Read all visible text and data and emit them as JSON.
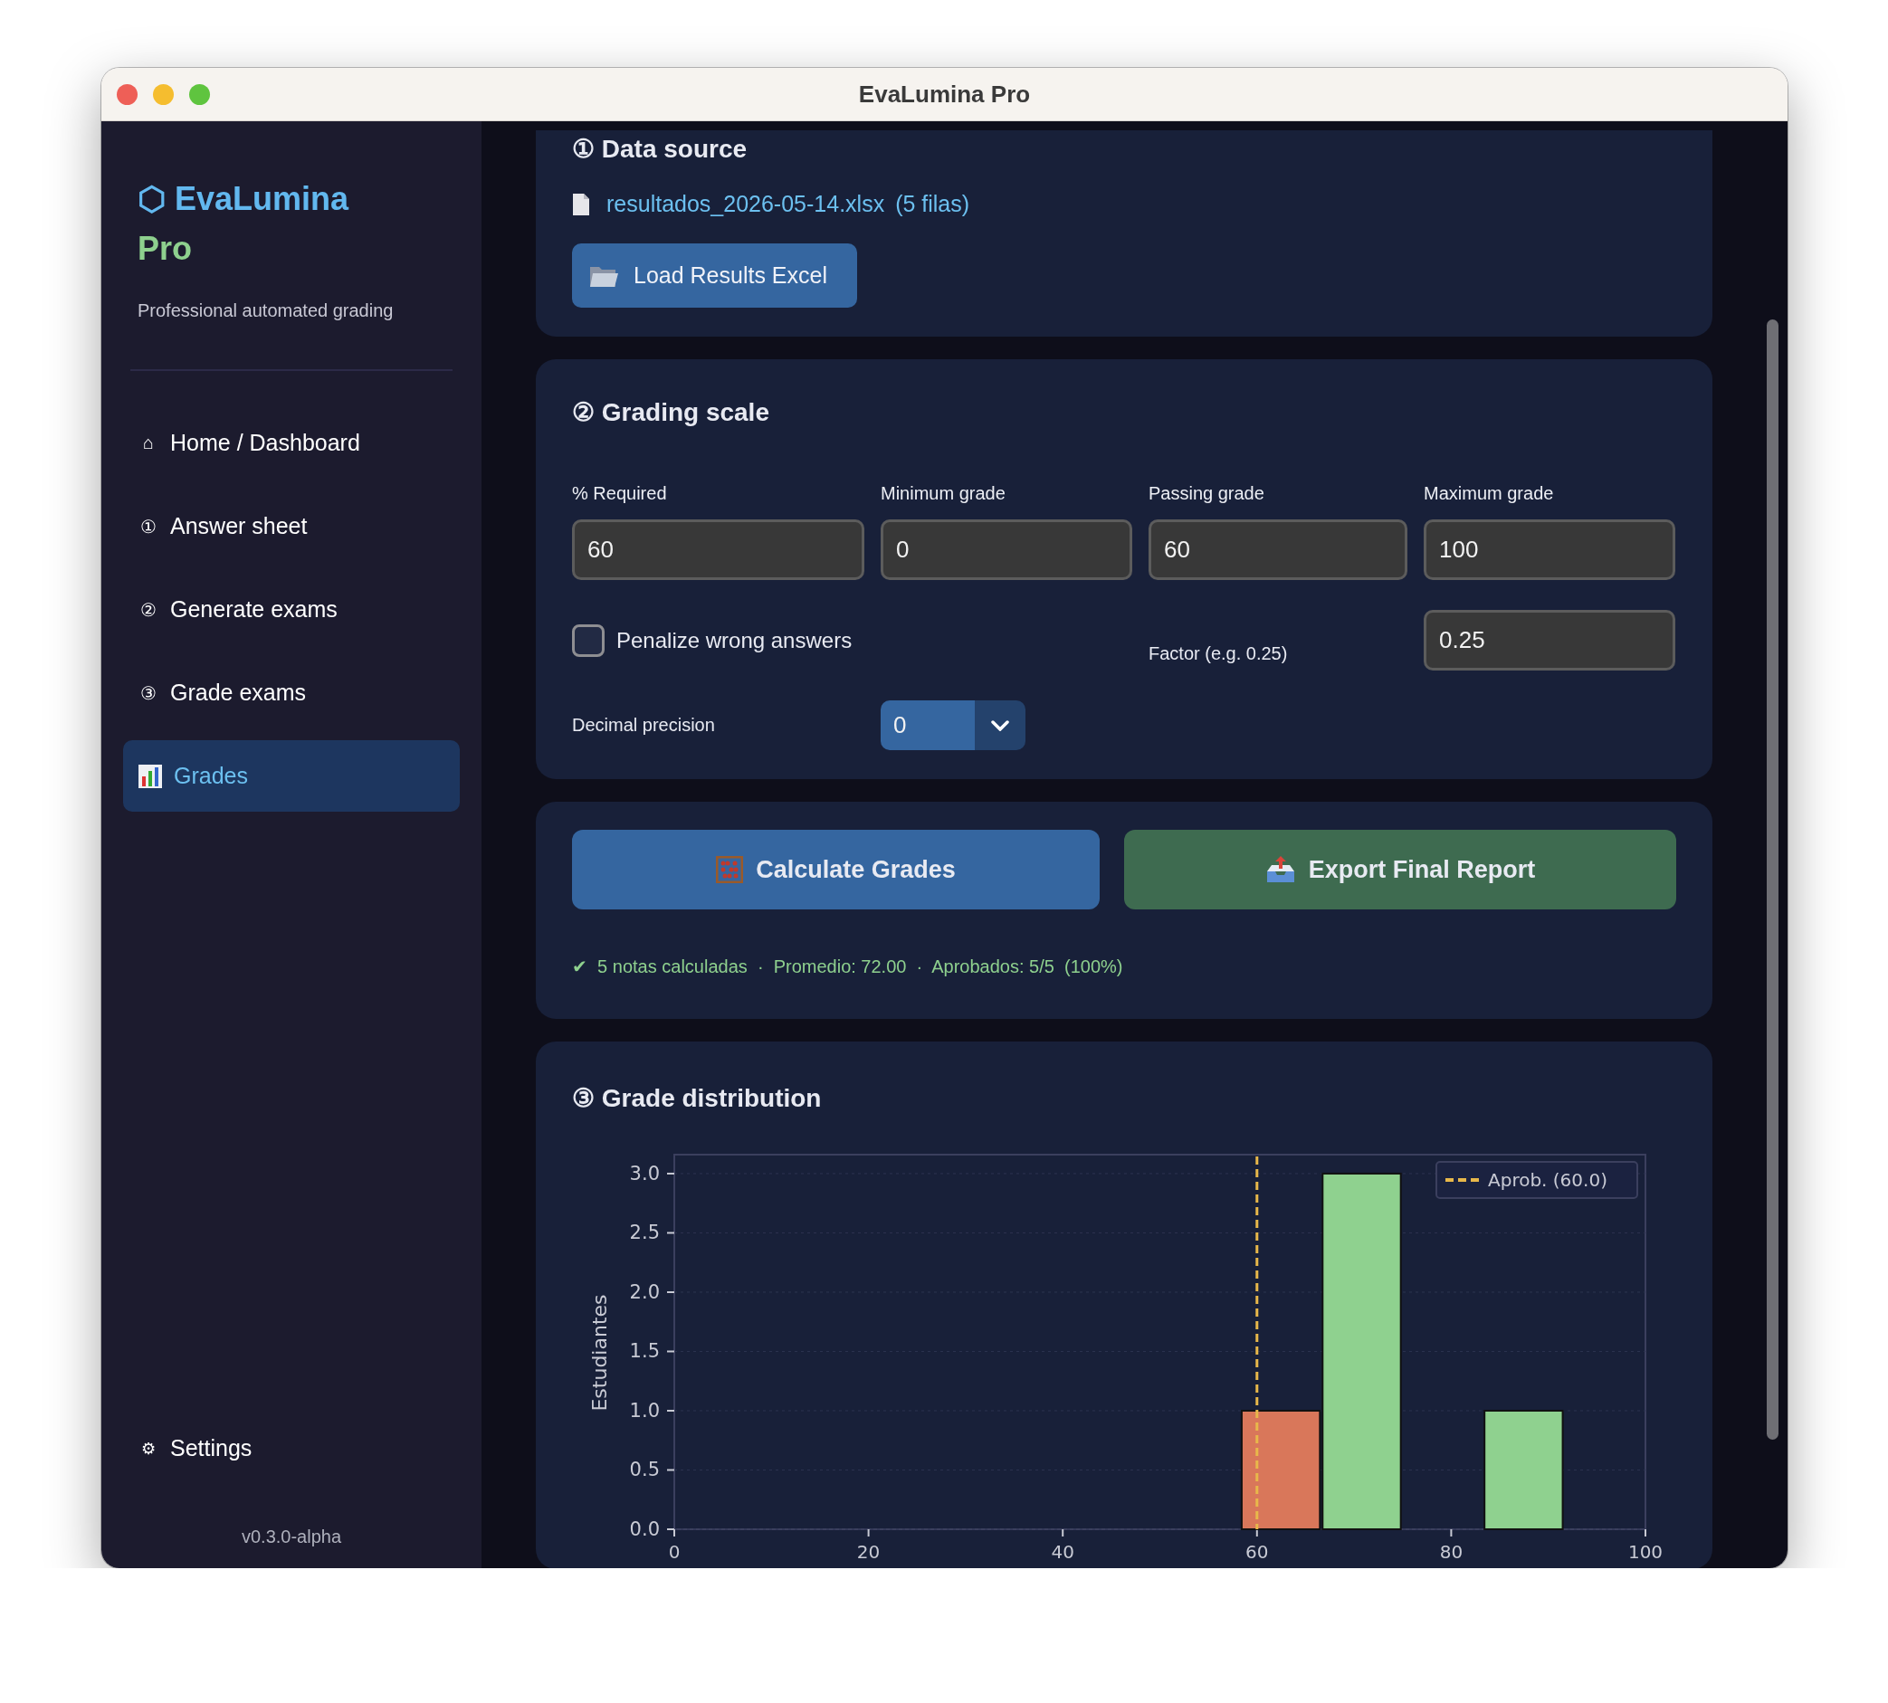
{
  "window": {
    "title": "EvaLumina Pro"
  },
  "sidebar": {
    "brand": {
      "icon": "⬡",
      "name": "EvaLumina",
      "edition": "Pro"
    },
    "subtitle": "Professional automated grading",
    "items": [
      {
        "kind": "glyph",
        "icon": "⌂",
        "label": "Home / Dashboard",
        "selected": false
      },
      {
        "kind": "glyph",
        "icon": "①",
        "label": "Answer sheet",
        "selected": false
      },
      {
        "kind": "glyph",
        "icon": "②",
        "label": "Generate exams",
        "selected": false
      },
      {
        "kind": "glyph",
        "icon": "③",
        "label": "Grade exams",
        "selected": false
      },
      {
        "kind": "chart",
        "label": "Grades",
        "selected": true
      }
    ],
    "settings": {
      "icon": "⚙",
      "label": "Settings"
    },
    "version": "v0.3.0-alpha"
  },
  "data_source": {
    "title": "① Data source",
    "file_name": "resultados_2026-05-14.xlsx",
    "row_count": "(5 filas)",
    "load_button": "Load Results Excel"
  },
  "grading_scale": {
    "title": "② Grading scale",
    "fields": [
      {
        "label": "% Required",
        "value": "60"
      },
      {
        "label": "Minimum grade",
        "value": "0"
      },
      {
        "label": "Passing grade",
        "value": "60"
      },
      {
        "label": "Maximum grade",
        "value": "100"
      }
    ],
    "penalize": {
      "label": "Penalize wrong answers",
      "checked": false
    },
    "factor": {
      "label": "Factor (e.g. 0.25)",
      "value": "0.25"
    },
    "precision": {
      "label": "Decimal precision",
      "value": "0"
    }
  },
  "actions": {
    "calculate_button": "Calculate Grades",
    "export_button": "Export Final Report",
    "status": "✔  5 notas calculadas  ·  Promedio: 72.00  ·  Aprobados: 5/5  (100%)"
  },
  "distribution": {
    "title": "③ Grade distribution",
    "chart_data": {
      "type": "bar",
      "ylabel": "Estudiantes",
      "x": [
        62.5,
        70.83,
        79.17,
        87.5
      ],
      "series": [
        {
          "color": "#d9775a",
          "values": [
            1,
            null,
            null,
            null
          ]
        },
        {
          "color": "#8fd18f",
          "values": [
            null,
            3,
            0,
            1
          ]
        }
      ],
      "grid": true,
      "xlim": [
        0,
        100
      ],
      "ylim": [
        0,
        3.16
      ],
      "xticks": [
        0,
        20,
        40,
        60,
        80,
        100
      ],
      "yticks": [
        {
          "value": 0,
          "label": "0.0"
        },
        {
          "value": 0.5,
          "label": "0.5"
        },
        {
          "value": 1,
          "label": "1.0"
        },
        {
          "value": 1.5,
          "label": "1.5"
        },
        {
          "value": 2,
          "label": "2.0"
        },
        {
          "value": 2.5,
          "label": "2.5"
        },
        {
          "value": 3,
          "label": "3.0"
        }
      ],
      "ref_lines": [
        {
          "axis": "x",
          "value": 60,
          "color": "#e8b84a"
        }
      ]
    },
    "legend": [
      {
        "label": "Aprob. (60.0)",
        "color": "#e8b84a"
      }
    ]
  }
}
